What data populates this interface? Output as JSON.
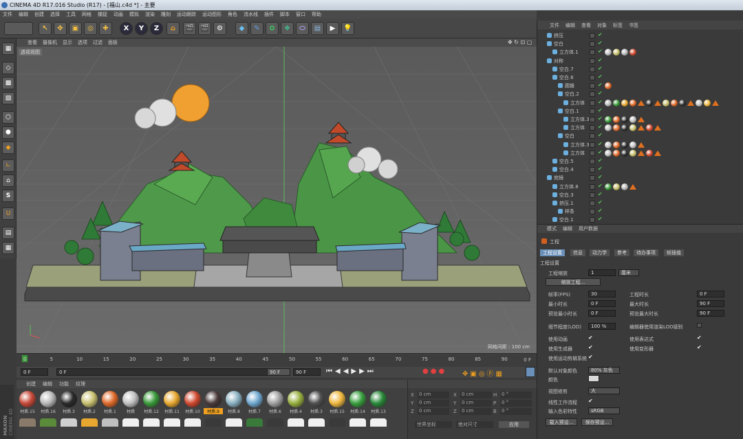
{
  "title": "CINEMA 4D R17.016 Studio (R17) - [福山.c4d *] - 主要",
  "menu": [
    "文件",
    "编辑",
    "创建",
    "选择",
    "工具",
    "网格",
    "捕捉",
    "动画",
    "模拟",
    "渲染",
    "雕刻",
    "运动跟踪",
    "运动图形",
    "角色",
    "流水线",
    "插件",
    "脚本",
    "窗口",
    "帮助"
  ],
  "toolbar": {
    "x": "X",
    "y": "Y",
    "z": "Z"
  },
  "viewport": {
    "menu": [
      "查看",
      "摄像机",
      "显示",
      "选项",
      "过滤",
      "面板"
    ],
    "label": "透视视图",
    "grid_info": "网格间距 : 100 cm"
  },
  "timeline": {
    "ticks": [
      "0",
      "5",
      "10",
      "15",
      "20",
      "25",
      "30",
      "35",
      "40",
      "45",
      "50",
      "55",
      "60",
      "65",
      "70",
      "75",
      "80",
      "85",
      "90"
    ],
    "end_label": "0 F",
    "start_field": "0 F",
    "cur_field": "0 F",
    "end_field": "90 F",
    "max_field": "90 F"
  },
  "materials": {
    "menu": [
      "创建",
      "编辑",
      "功能",
      "纹理"
    ],
    "items": [
      {
        "label": "材质.15",
        "color": "#c84a3a"
      },
      {
        "label": "材质.16",
        "color": "#b8b8b8"
      },
      {
        "label": "材质.3",
        "color": "#2a2a2a"
      },
      {
        "label": "材质.2",
        "color": "#c8c070"
      },
      {
        "label": "材质.1",
        "color": "#e06a2a"
      },
      {
        "label": "材质",
        "color": "#c0c0c0"
      },
      {
        "label": "材质.12",
        "color": "#3a9a3a"
      },
      {
        "label": "材质.11",
        "color": "#e8a830"
      },
      {
        "label": "材质.10",
        "color": "#d04a30"
      },
      {
        "label": "材质.9",
        "color": "#4a3a3a"
      },
      {
        "label": "材质.8",
        "color": "#8ab0c0"
      },
      {
        "label": "材质.7",
        "color": "#70a8d0"
      },
      {
        "label": "材质.6",
        "color": "#a0a0a0"
      },
      {
        "label": "材质.4",
        "color": "#98b040"
      },
      {
        "label": "材质.3",
        "color": "#505050"
      },
      {
        "label": "材质.15",
        "color": "#f0b840"
      },
      {
        "label": "材质.14",
        "color": "#3aa040"
      },
      {
        "label": "材质.13",
        "color": "#2a8a3a"
      }
    ],
    "selected_index": 9
  },
  "coords": {
    "rows": [
      {
        "a": "X",
        "av": "0 cm",
        "b": "X",
        "bv": "0 cm",
        "c": "H",
        "cv": "0 °"
      },
      {
        "a": "Y",
        "av": "0 cm",
        "b": "Y",
        "bv": "0 cm",
        "c": "P",
        "cv": "0 °"
      },
      {
        "a": "Z",
        "av": "0 cm",
        "b": "Z",
        "bv": "0 cm",
        "c": "B",
        "cv": "0 °"
      }
    ],
    "mode1": "世界坐标",
    "mode2": "绝对尺寸",
    "apply": "应用"
  },
  "brand": {
    "maxon": "MAXON",
    "c4d": "CINEMA 4D"
  },
  "objects": {
    "menu": [
      "文件",
      "编辑",
      "查看",
      "对象",
      "标签",
      "书签"
    ],
    "rows": [
      {
        "name": "挤压",
        "indent": 0
      },
      {
        "name": "空白",
        "indent": 0
      },
      {
        "name": "立方体.1",
        "indent": 1
      },
      {
        "name": "对称",
        "indent": 0
      },
      {
        "name": "空白.7",
        "indent": 1
      },
      {
        "name": "空白.6",
        "indent": 1
      },
      {
        "name": "圆锥",
        "indent": 2
      },
      {
        "name": "空白.2",
        "indent": 2
      },
      {
        "name": "立方体",
        "indent": 3
      },
      {
        "name": "空白.1",
        "indent": 2
      },
      {
        "name": "立方体.3",
        "indent": 3
      },
      {
        "name": "立方体",
        "indent": 3
      },
      {
        "name": "空白",
        "indent": 2
      },
      {
        "name": "立方体.3",
        "indent": 3
      },
      {
        "name": "立方体",
        "indent": 3
      },
      {
        "name": "空白.5",
        "indent": 1
      },
      {
        "name": "空白.4",
        "indent": 1
      },
      {
        "name": "宛镜",
        "indent": 0
      },
      {
        "name": "立方体.8",
        "indent": 1
      },
      {
        "name": "空白.3",
        "indent": 1
      },
      {
        "name": "挤压.1",
        "indent": 1
      },
      {
        "name": "样条",
        "indent": 2
      },
      {
        "name": "空白.1",
        "indent": 1
      }
    ]
  },
  "attributes": {
    "menu": [
      "模式",
      "编辑",
      "用户数据"
    ],
    "header": "工程",
    "tabs": [
      "工程设置",
      "信息",
      "动力学",
      "参考",
      "待办事项",
      "帧插值"
    ],
    "section": "工程设置",
    "scale_label": "工程缩放",
    "scale_value": "1",
    "scale_unit": "厘米",
    "scale_btn": "缩放工程...",
    "fps_label": "帧率(FPS)",
    "fps_value": "30",
    "duration_label": "工程时长",
    "duration_value": "0 F",
    "min_label": "最小时长",
    "min_value": "0 F",
    "max_label": "最大时长",
    "max_value": "90 F",
    "pmin_label": "预览最小时长",
    "pmin_value": "0 F",
    "pmax_label": "预览最大时长",
    "pmax_value": "90 F",
    "lod_label": "细节程度(LOD)",
    "lod_value": "100 %",
    "lod_render": "编辑器使用渲染LOD级别",
    "use_anim": "使用动画",
    "use_expr": "使用表达式",
    "use_gen": "使用生成器",
    "use_deform": "使用变形器",
    "use_mograph": "使用运动剪辑系统",
    "default_color_label": "默认对象颜色",
    "default_color_value": "80% 灰色",
    "color_label": "颜色",
    "clip_label": "视图修剪",
    "clip_value": "大",
    "linear_label": "线性工作流程",
    "input_label": "输入色彩特性",
    "input_value": "sRGB",
    "load_btn": "载入预设...",
    "save_btn": "保存预设..."
  }
}
